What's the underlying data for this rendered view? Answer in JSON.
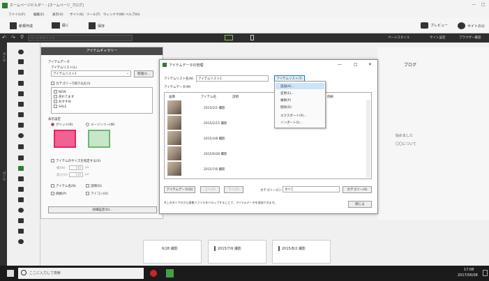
{
  "window": {
    "title": "ホームページビルダー - [ホームページ_ブログ]",
    "menus": [
      "ファイル(F)",
      "編集(E)",
      "表示(V)",
      "サイト(S)",
      "ツール(T)",
      "ウィンドウ(W)",
      "ヘルプ(H)"
    ]
  },
  "toolbar": {
    "new_label": "新規作成",
    "open_label": "開く",
    "save_label": "保存",
    "preview_label": "プレビュー",
    "site_label": "サイトの公"
  },
  "navbar": {
    "title_placeholder": "ページのタイトル",
    "page_style": "ページスタイル",
    "site_settings": "サイト設定",
    "browser_check": "ブラウザー確認"
  },
  "side_tabs": {
    "pages": "ページ",
    "parts": "パーツ"
  },
  "gallery": {
    "title": "アイテムギャラリー",
    "item_data": "アイテムデータ",
    "item_list_label": "アイテムリスト(L)",
    "item_list_value": "アイテムリスト1",
    "manage_button": "管理(I)...",
    "category_filter": "カテゴリーで絞り込む(I)",
    "categories": [
      "NEW",
      "売れてます",
      "おすすめ",
      "SALE"
    ],
    "display_settings": "表示設定",
    "grid_label": "グリッド(R)",
    "masonry_label": "メーソンリー(M)",
    "size_label": "アイテムのサイズを指定する(S)",
    "width_label": "幅(W)",
    "width_value": "150",
    "height_label": "高さ(H)",
    "height_value": "110",
    "unit": "px",
    "name_label": "アイテム名(N)",
    "desc_label": "説明(D)",
    "price_label": "価格(P)",
    "icon_label": "アイコン(O)",
    "details_button": "詳細設定(D)..."
  },
  "dialog": {
    "title": "アイテムデータの管理",
    "list_name_label": "アイテムリスト名(N)",
    "list_name_value": "アイテムリスト1",
    "item_list_button": "アイテムリスト(T)",
    "item_data_label": "アイテムデータ(M)",
    "columns": [
      "画像",
      "アイテム名",
      "説明",
      "価格"
    ],
    "rows": [
      {
        "name": "2015/2/1 撮影"
      },
      {
        "name": "2015/2/15 撮影"
      },
      {
        "name": "2015/3/8 撮影"
      },
      {
        "name": "2015/6/28 撮影"
      },
      {
        "name": "2015/7/6 撮影"
      }
    ],
    "add_data_button": "アイテムデータ(D)",
    "up_button": "上へ(U)",
    "down_button": "下へ(O)",
    "category_label": "カテゴリー(C)：",
    "category_value": "すべて",
    "category_button": "カテゴリー(A)",
    "hint": "※このダイアログに画像ファイルをドロップすることで、アイテムデータを追加できます。",
    "close_button": "閉じる",
    "window_min": "—",
    "window_max": "□",
    "window_close": "✕"
  },
  "menu": {
    "items": [
      "追加(A)...",
      "変更(E)...",
      "複製(P)",
      "削除(D)",
      "エクスポート(X)...",
      "インポート(I)..."
    ]
  },
  "blog": {
    "heading": "ブログ",
    "line1": "始めました",
    "line2": "〇〇について"
  },
  "cards": [
    {
      "label": "6/28 撮影"
    },
    {
      "label": "2015/7/6 撮影"
    },
    {
      "label": "2015/8/2 撮影"
    }
  ],
  "taskbar": {
    "search_placeholder": "ここに入力して検索",
    "time": "17:08",
    "date": "2017/06/08"
  }
}
